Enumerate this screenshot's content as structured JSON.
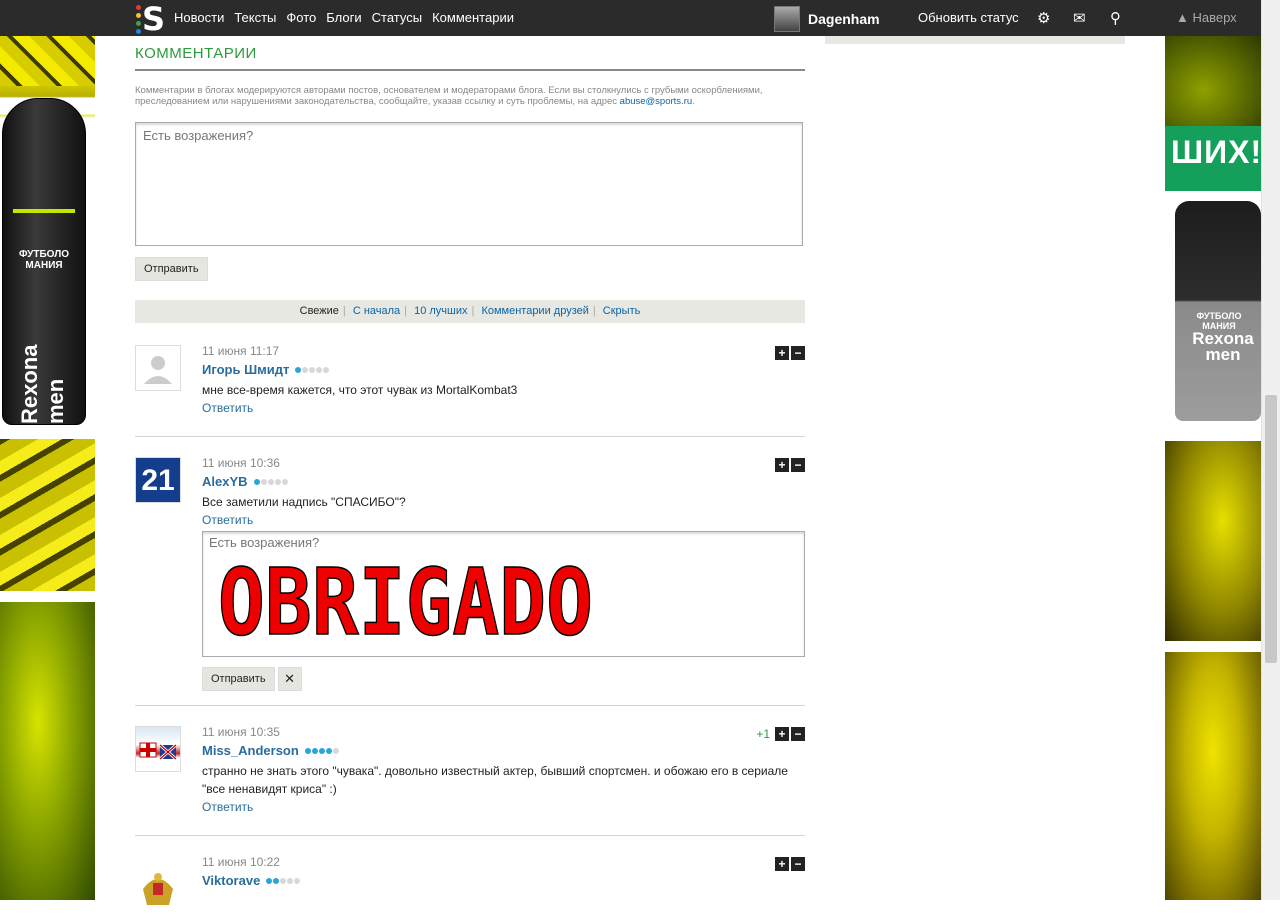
{
  "nav": {
    "links": [
      "Новости",
      "Тексты",
      "Фото",
      "Блоги",
      "Статусы",
      "Комментарии"
    ],
    "username": "Dagenham",
    "update_status": "Обновить статус",
    "to_top": "▲ Наверх"
  },
  "comments_section": {
    "heading": "КОММЕНТАРИИ",
    "notice": "Комментарии в блогах модерируются авторами постов, основателем и модераторами блога. Если вы столкнулись с грубыми оскорблениями, преследованием или нарушениями законодательства, сообщайте, указав ссылку и суть проблемы, на адрес",
    "notice_email": "abuse@sports.ru",
    "textarea_placeholder": "Есть возражения?",
    "send_label": "Отправить",
    "filters": {
      "fresh": "Свежие",
      "from_start": "С начала",
      "top10": "10 лучших",
      "friends": "Комментарии друзей",
      "hide": "Скрыть"
    }
  },
  "comments": [
    {
      "date": "11 июня 11:17",
      "author": "Игорь Шмидт",
      "level": 1,
      "text": "мне все-время кажется, что этот чувак из MortalKombat3",
      "reply": "Ответить",
      "score": ""
    },
    {
      "date": "11 июня 10:36",
      "author": "AlexYB",
      "level": 1,
      "text": "Все заметили надпись \"СПАСИБО\"?",
      "reply": "Ответить",
      "score": "",
      "avatar_text": "21"
    },
    {
      "date": "11 июня 10:35",
      "author": "Miss_Anderson",
      "level": 4,
      "text": "странно не знать этого \"чувака\". довольно известный актер, бывший спортсмен. и обожаю его в сериале \"все ненавидят криса\" :)",
      "reply": "Ответить",
      "score": "+1"
    },
    {
      "date": "11 июня 10:22",
      "author": "Viktorave",
      "level": 2,
      "text": "",
      "reply": "",
      "score": ""
    }
  ],
  "reply_form": {
    "placeholder": "Есть возражения?",
    "image_text": "OBRIGADO",
    "send_label": "Отправить",
    "close_label": "✕"
  },
  "ads": {
    "left_line1": "ФУТБОЛО",
    "left_line2": "МАНИЯ",
    "left_brand": "Rexona men",
    "right_banner": "ШИХ!",
    "right_line1": "ФУТБОЛО",
    "right_line2": "МАНИЯ",
    "right_brand": "Rexona men"
  },
  "colors": {
    "heading_green": "#2d9a3c",
    "link_blue": "#2b6c9b",
    "level_dot": "#2ba5d8",
    "topbar": "#2b2b2b"
  }
}
